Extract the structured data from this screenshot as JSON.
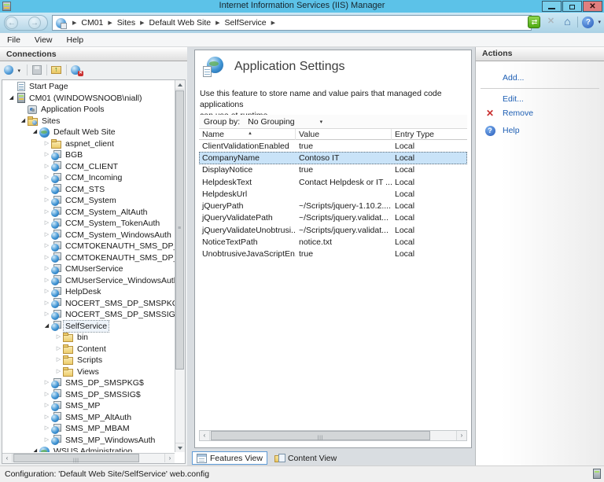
{
  "window": {
    "title": "Internet Information Services (IIS) Manager"
  },
  "titlebar_buttons": {
    "minimize": "minimize",
    "restore": "restore",
    "close": "close"
  },
  "address": {
    "crumbs": [
      "CM01",
      "Sites",
      "Default Web Site",
      "SelfService"
    ],
    "toolbar_icons": [
      "restart-icon",
      "stop-icon",
      "home-icon",
      "help-icon"
    ]
  },
  "menu": {
    "items": [
      "File",
      "View",
      "Help"
    ]
  },
  "connections": {
    "title": "Connections",
    "toolbar_icons": [
      "connect-icon",
      "save-icon",
      "up-icon",
      "delete-connection-icon"
    ],
    "tree": [
      {
        "label": "Start Page",
        "level": 0,
        "arrow": "none",
        "icon": "page"
      },
      {
        "label": "CM01 (WINDOWSNOOB\\niall)",
        "level": 0,
        "arrow": "open",
        "icon": "server"
      },
      {
        "label": "Application Pools",
        "level": 1,
        "arrow": "none",
        "icon": "pools"
      },
      {
        "label": "Sites",
        "level": 1,
        "arrow": "open",
        "icon": "sites"
      },
      {
        "label": "Default Web Site",
        "level": 2,
        "arrow": "open",
        "icon": "globe"
      },
      {
        "label": "aspnet_client",
        "level": 3,
        "arrow": "closed",
        "icon": "folder"
      },
      {
        "label": "BGB",
        "level": 3,
        "arrow": "closed",
        "icon": "app"
      },
      {
        "label": "CCM_CLIENT",
        "level": 3,
        "arrow": "closed",
        "icon": "app"
      },
      {
        "label": "CCM_Incoming",
        "level": 3,
        "arrow": "closed",
        "icon": "app"
      },
      {
        "label": "CCM_STS",
        "level": 3,
        "arrow": "closed",
        "icon": "app"
      },
      {
        "label": "CCM_System",
        "level": 3,
        "arrow": "closed",
        "icon": "app"
      },
      {
        "label": "CCM_System_AltAuth",
        "level": 3,
        "arrow": "closed",
        "icon": "app"
      },
      {
        "label": "CCM_System_TokenAuth",
        "level": 3,
        "arrow": "closed",
        "icon": "app"
      },
      {
        "label": "CCM_System_WindowsAuth",
        "level": 3,
        "arrow": "closed",
        "icon": "app"
      },
      {
        "label": "CCMTOKENAUTH_SMS_DP_SMSPKG$",
        "level": 3,
        "arrow": "closed",
        "icon": "app"
      },
      {
        "label": "CCMTOKENAUTH_SMS_DP_SMSSIG$",
        "level": 3,
        "arrow": "closed",
        "icon": "app"
      },
      {
        "label": "CMUserService",
        "level": 3,
        "arrow": "closed",
        "icon": "app"
      },
      {
        "label": "CMUserService_WindowsAuth",
        "level": 3,
        "arrow": "closed",
        "icon": "app"
      },
      {
        "label": "HelpDesk",
        "level": 3,
        "arrow": "closed",
        "icon": "app"
      },
      {
        "label": "NOCERT_SMS_DP_SMSPKG$",
        "level": 3,
        "arrow": "closed",
        "icon": "app"
      },
      {
        "label": "NOCERT_SMS_DP_SMSSIG$",
        "level": 3,
        "arrow": "closed",
        "icon": "app"
      },
      {
        "label": "SelfService",
        "level": 3,
        "arrow": "open",
        "icon": "app",
        "selected": true
      },
      {
        "label": "bin",
        "level": 4,
        "arrow": "closed",
        "icon": "folder"
      },
      {
        "label": "Content",
        "level": 4,
        "arrow": "closed",
        "icon": "folder"
      },
      {
        "label": "Scripts",
        "level": 4,
        "arrow": "closed",
        "icon": "folder"
      },
      {
        "label": "Views",
        "level": 4,
        "arrow": "closed",
        "icon": "folder"
      },
      {
        "label": "SMS_DP_SMSPKG$",
        "level": 3,
        "arrow": "closed",
        "icon": "app"
      },
      {
        "label": "SMS_DP_SMSSIG$",
        "level": 3,
        "arrow": "closed",
        "icon": "app"
      },
      {
        "label": "SMS_MP",
        "level": 3,
        "arrow": "closed",
        "icon": "app"
      },
      {
        "label": "SMS_MP_AltAuth",
        "level": 3,
        "arrow": "closed",
        "icon": "app"
      },
      {
        "label": "SMS_MP_MBAM",
        "level": 3,
        "arrow": "closed",
        "icon": "app"
      },
      {
        "label": "SMS_MP_WindowsAuth",
        "level": 3,
        "arrow": "closed",
        "icon": "app"
      },
      {
        "label": "WSUS Administration",
        "level": 2,
        "arrow": "open",
        "icon": "globe"
      }
    ]
  },
  "feature": {
    "title": "Application Settings",
    "description_lines": [
      "Use this feature to store name and value pairs that managed code applications",
      "can use at runtime."
    ],
    "group_by_label": "Group by:",
    "group_by_value": "No Grouping",
    "columns": [
      "Name",
      "Value",
      "Entry Type"
    ],
    "rows": [
      {
        "name": "ClientValidationEnabled",
        "value": "true",
        "entry_type": "Local",
        "selected": false
      },
      {
        "name": "CompanyName",
        "value": "Contoso IT",
        "entry_type": "Local",
        "selected": true
      },
      {
        "name": "DisplayNotice",
        "value": "true",
        "entry_type": "Local",
        "selected": false
      },
      {
        "name": "HelpdeskText",
        "value": "Contact Helpdesk or IT ...",
        "entry_type": "Local",
        "selected": false
      },
      {
        "name": "HelpdeskUrl",
        "value": "",
        "entry_type": "Local",
        "selected": false
      },
      {
        "name": "jQueryPath",
        "value": "~/Scripts/jquery-1.10.2....",
        "entry_type": "Local",
        "selected": false
      },
      {
        "name": "jQueryValidatePath",
        "value": "~/Scripts/jquery.validat...",
        "entry_type": "Local",
        "selected": false
      },
      {
        "name": "jQueryValidateUnobtrusi...",
        "value": "~/Scripts/jquery.validat...",
        "entry_type": "Local",
        "selected": false
      },
      {
        "name": "NoticeTextPath",
        "value": "notice.txt",
        "entry_type": "Local",
        "selected": false
      },
      {
        "name": "UnobtrusiveJavaScriptEn...",
        "value": "true",
        "entry_type": "Local",
        "selected": false
      }
    ]
  },
  "tabs": {
    "features": "Features View",
    "content": "Content View"
  },
  "actions": {
    "title": "Actions",
    "add": "Add...",
    "edit": "Edit...",
    "remove": "Remove",
    "help": "Help"
  },
  "statusbar": {
    "text": "Configuration: 'Default Web Site/SelfService' web.config"
  },
  "colors": {
    "titlebar": "#5cc2e8",
    "link_blue": "#1e5fb4",
    "selection_blue": "#c9e3f8",
    "remove_red": "#c92f2f",
    "help_badge_blue": "#2458b8",
    "close_button_red": "#e07f7f"
  }
}
